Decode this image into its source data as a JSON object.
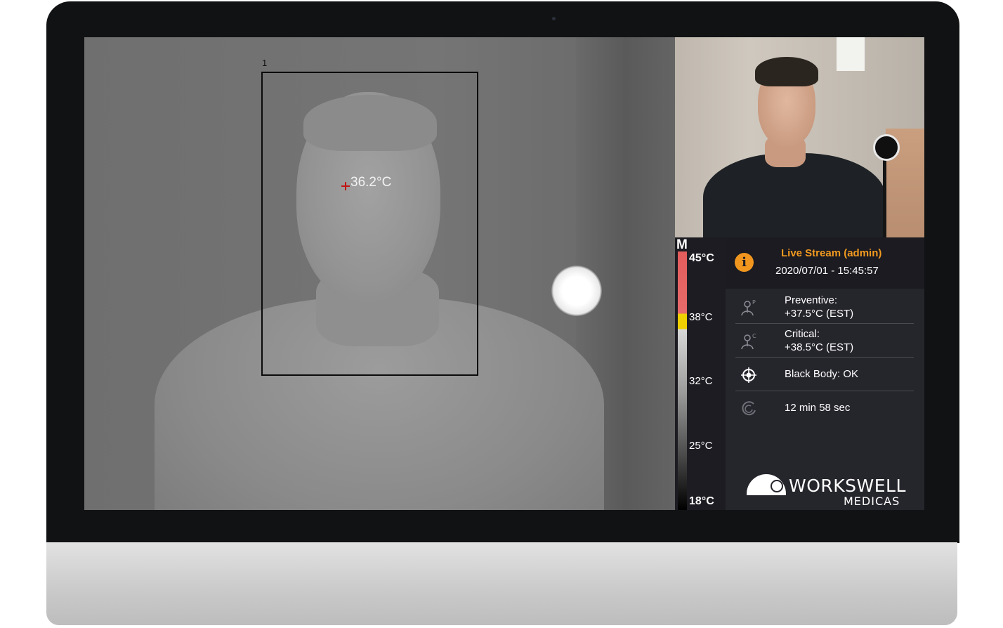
{
  "thermal_view": {
    "roi_label": "1",
    "spot_temperature": "36.2°C"
  },
  "scale": {
    "mode": "M",
    "ticks": [
      "45°C",
      "38°C",
      "32°C",
      "25°C",
      "18°C"
    ],
    "colors": {
      "hot": "#e35c5c",
      "alarm": "#f0d000",
      "cold": "#000000"
    }
  },
  "status_panel": {
    "title": "Live Stream (admin)",
    "datetime": "2020/07/01 -  15:45:57",
    "preventive": {
      "label": "Preventive:",
      "value": "+37.5°C (EST)",
      "icon": "thermometer-person-p-icon"
    },
    "critical": {
      "label": "Critical:",
      "value": "+38.5°C (EST)",
      "icon": "thermometer-person-c-icon"
    },
    "blackbody": {
      "label": "Black Body: OK",
      "icon": "target-icon"
    },
    "uptime": {
      "label": "12 min 58 sec",
      "icon": "timer-icon"
    },
    "accent_color": "#f39a1f"
  },
  "logo": {
    "line1": "WORKSWELL",
    "line2": "MEDICAS"
  }
}
